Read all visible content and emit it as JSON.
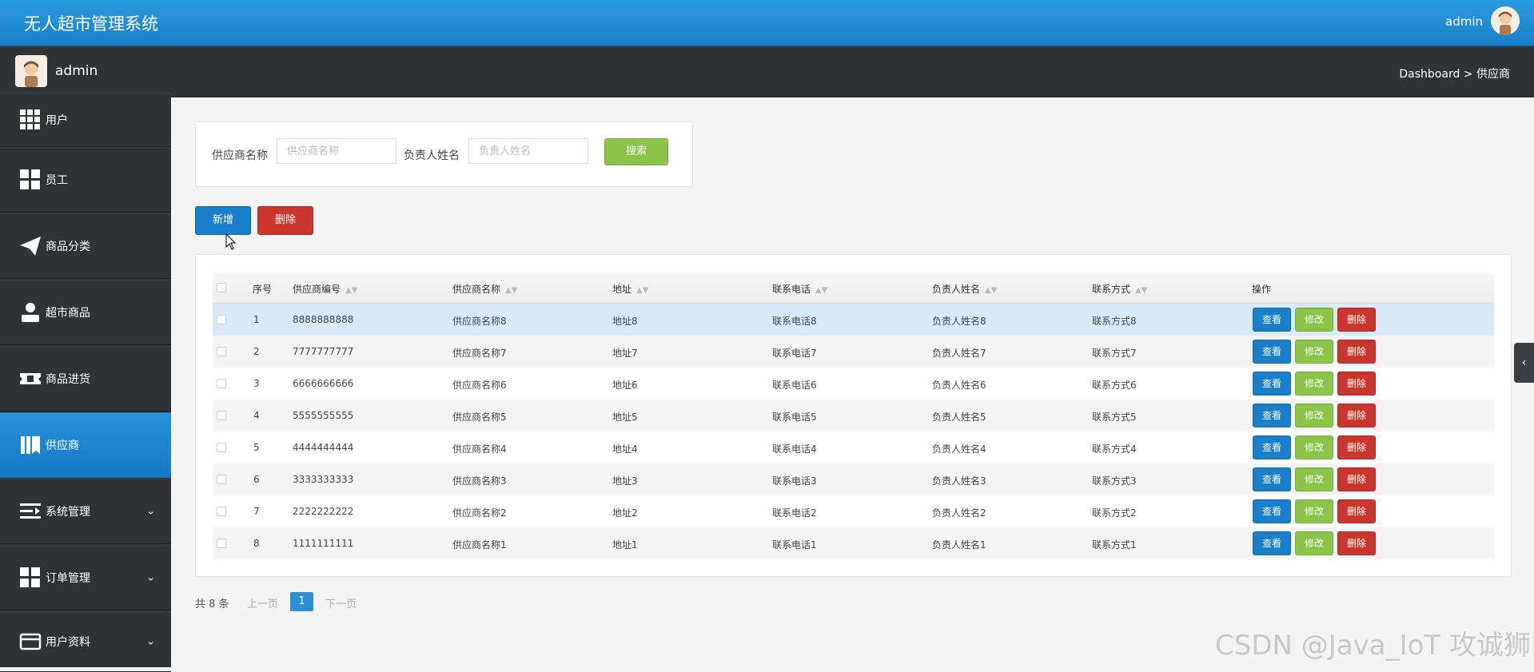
{
  "app": {
    "title": "无人超市管理系统",
    "user": "admin"
  },
  "subbar": {
    "user": "admin",
    "breadcrumb": "Dashboard > 供应商"
  },
  "sidebar": {
    "items": [
      {
        "label": "用户",
        "icon": "grid-icon"
      },
      {
        "label": "员工",
        "icon": "dashboard-icon"
      },
      {
        "label": "商品分类",
        "icon": "paper-plane-icon"
      },
      {
        "label": "超市商品",
        "icon": "user-icon"
      },
      {
        "label": "商品进货",
        "icon": "ticket-icon"
      },
      {
        "label": "供应商",
        "icon": "book-icon",
        "active": true
      },
      {
        "label": "系统管理",
        "icon": "indent-icon",
        "expandable": true
      },
      {
        "label": "订单管理",
        "icon": "dashboard-icon",
        "expandable": true
      },
      {
        "label": "用户资料",
        "icon": "credit-card-icon",
        "expandable": true
      }
    ]
  },
  "search": {
    "supplier_name_label": "供应商名称",
    "supplier_name_placeholder": "供应商名称",
    "contact_person_label": "负责人姓名",
    "contact_person_placeholder": "负责人姓名",
    "search_button": "搜索"
  },
  "actions": {
    "add": "新增",
    "delete": "删除"
  },
  "table": {
    "headers": [
      "序号",
      "供应商编号",
      "供应商名称",
      "地址",
      "联系电话",
      "负责人姓名",
      "联系方式",
      "操作"
    ],
    "row_actions": {
      "view": "查看",
      "edit": "修改",
      "delete": "删除"
    },
    "rows": [
      {
        "no": "1",
        "code": "8888888888",
        "name": "供应商名称8",
        "address": "地址8",
        "phone": "联系电话8",
        "person": "负责人姓名8",
        "contact": "联系方式8"
      },
      {
        "no": "2",
        "code": "7777777777",
        "name": "供应商名称7",
        "address": "地址7",
        "phone": "联系电话7",
        "person": "负责人姓名7",
        "contact": "联系方式7"
      },
      {
        "no": "3",
        "code": "6666666666",
        "name": "供应商名称6",
        "address": "地址6",
        "phone": "联系电话6",
        "person": "负责人姓名6",
        "contact": "联系方式6"
      },
      {
        "no": "4",
        "code": "5555555555",
        "name": "供应商名称5",
        "address": "地址5",
        "phone": "联系电话5",
        "person": "负责人姓名5",
        "contact": "联系方式5"
      },
      {
        "no": "5",
        "code": "4444444444",
        "name": "供应商名称4",
        "address": "地址4",
        "phone": "联系电话4",
        "person": "负责人姓名4",
        "contact": "联系方式4"
      },
      {
        "no": "6",
        "code": "3333333333",
        "name": "供应商名称3",
        "address": "地址3",
        "phone": "联系电话3",
        "person": "负责人姓名3",
        "contact": "联系方式3"
      },
      {
        "no": "7",
        "code": "2222222222",
        "name": "供应商名称2",
        "address": "地址2",
        "phone": "联系电话2",
        "person": "负责人姓名2",
        "contact": "联系方式2"
      },
      {
        "no": "8",
        "code": "1111111111",
        "name": "供应商名称1",
        "address": "地址1",
        "phone": "联系电话1",
        "person": "负责人姓名1",
        "contact": "联系方式1"
      }
    ]
  },
  "pager": {
    "total": "共 8 条",
    "prev": "上一页",
    "current": "1",
    "next": "下一页"
  },
  "watermark": "CSDN @Java_IoT 攻诚狮",
  "colors": {
    "primary": "#1a7ec9",
    "success": "#8cc34a",
    "danger": "#c9362e",
    "sidebar": "#303336"
  }
}
